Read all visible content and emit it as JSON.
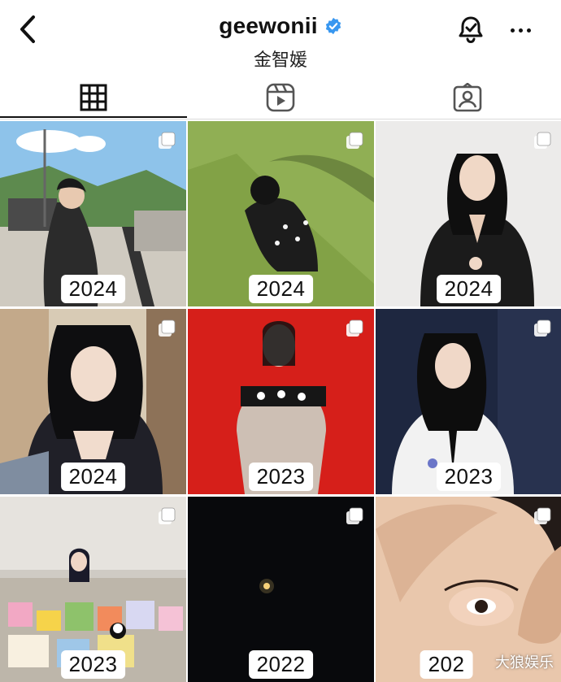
{
  "header": {
    "username": "geewonii",
    "real_name": "金智媛",
    "accent": "#3897f0"
  },
  "tabs": [
    {
      "name": "posts",
      "icon": "grid-icon",
      "active": true
    },
    {
      "name": "reels",
      "icon": "reels-icon",
      "active": false
    },
    {
      "name": "tagged",
      "icon": "tagged-icon",
      "active": false
    }
  ],
  "posts": [
    {
      "year": "2024",
      "icon": "multi-photo-icon"
    },
    {
      "year": "2024",
      "icon": "multi-photo-icon"
    },
    {
      "year": "2024",
      "icon": "multi-photo-icon"
    },
    {
      "year": "2024",
      "icon": "multi-photo-icon"
    },
    {
      "year": "2023",
      "icon": "multi-photo-icon"
    },
    {
      "year": "2023",
      "icon": "multi-photo-icon"
    },
    {
      "year": "2023",
      "icon": "multi-photo-icon"
    },
    {
      "year": "2022",
      "icon": "multi-photo-icon"
    },
    {
      "year": "202",
      "icon": "multi-photo-icon"
    }
  ],
  "watermark": "大狼娱乐"
}
